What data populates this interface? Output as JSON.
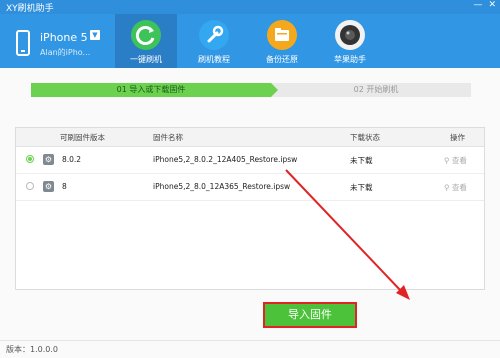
{
  "app": {
    "title": "XY刷机助手"
  },
  "window_controls": {
    "minimize": "—",
    "close": "✕"
  },
  "device": {
    "name": "iPhone 5",
    "caret": "▼",
    "subtitle": "Alan的iPho..."
  },
  "nav": {
    "tabs": [
      {
        "label": "一键刷机",
        "icon": "refresh-icon",
        "active": true
      },
      {
        "label": "刷机教程",
        "icon": "wrench-icon",
        "active": false
      },
      {
        "label": "备份还原",
        "icon": "folder-icon",
        "active": false
      },
      {
        "label": "苹果助手",
        "icon": "camera-lens-icon",
        "active": false
      }
    ]
  },
  "steps": {
    "step1": "01  导入或下载固件",
    "step2": "02  开始刷机"
  },
  "table": {
    "headers": {
      "version": "可刷固件版本",
      "name": "固件名称",
      "status": "下载状态",
      "action": "操作"
    },
    "rows": [
      {
        "version": "8.0.2",
        "name": "iPhone5,2_8.0.2_12A405_Restore.ipsw",
        "status": "未下载",
        "action": "查看",
        "selected": true
      },
      {
        "version": "8",
        "name": "iPhone5,2_8.0_12A365_Restore.ipsw",
        "status": "未下载",
        "action": "查看",
        "selected": false
      }
    ]
  },
  "import_button": {
    "label": "导入固件"
  },
  "statusbar": {
    "version": "版本：1.0.0.0"
  },
  "colors": {
    "header": "#3196e3",
    "accent_green": "#6bd14f",
    "annotation_red": "#e02424"
  }
}
